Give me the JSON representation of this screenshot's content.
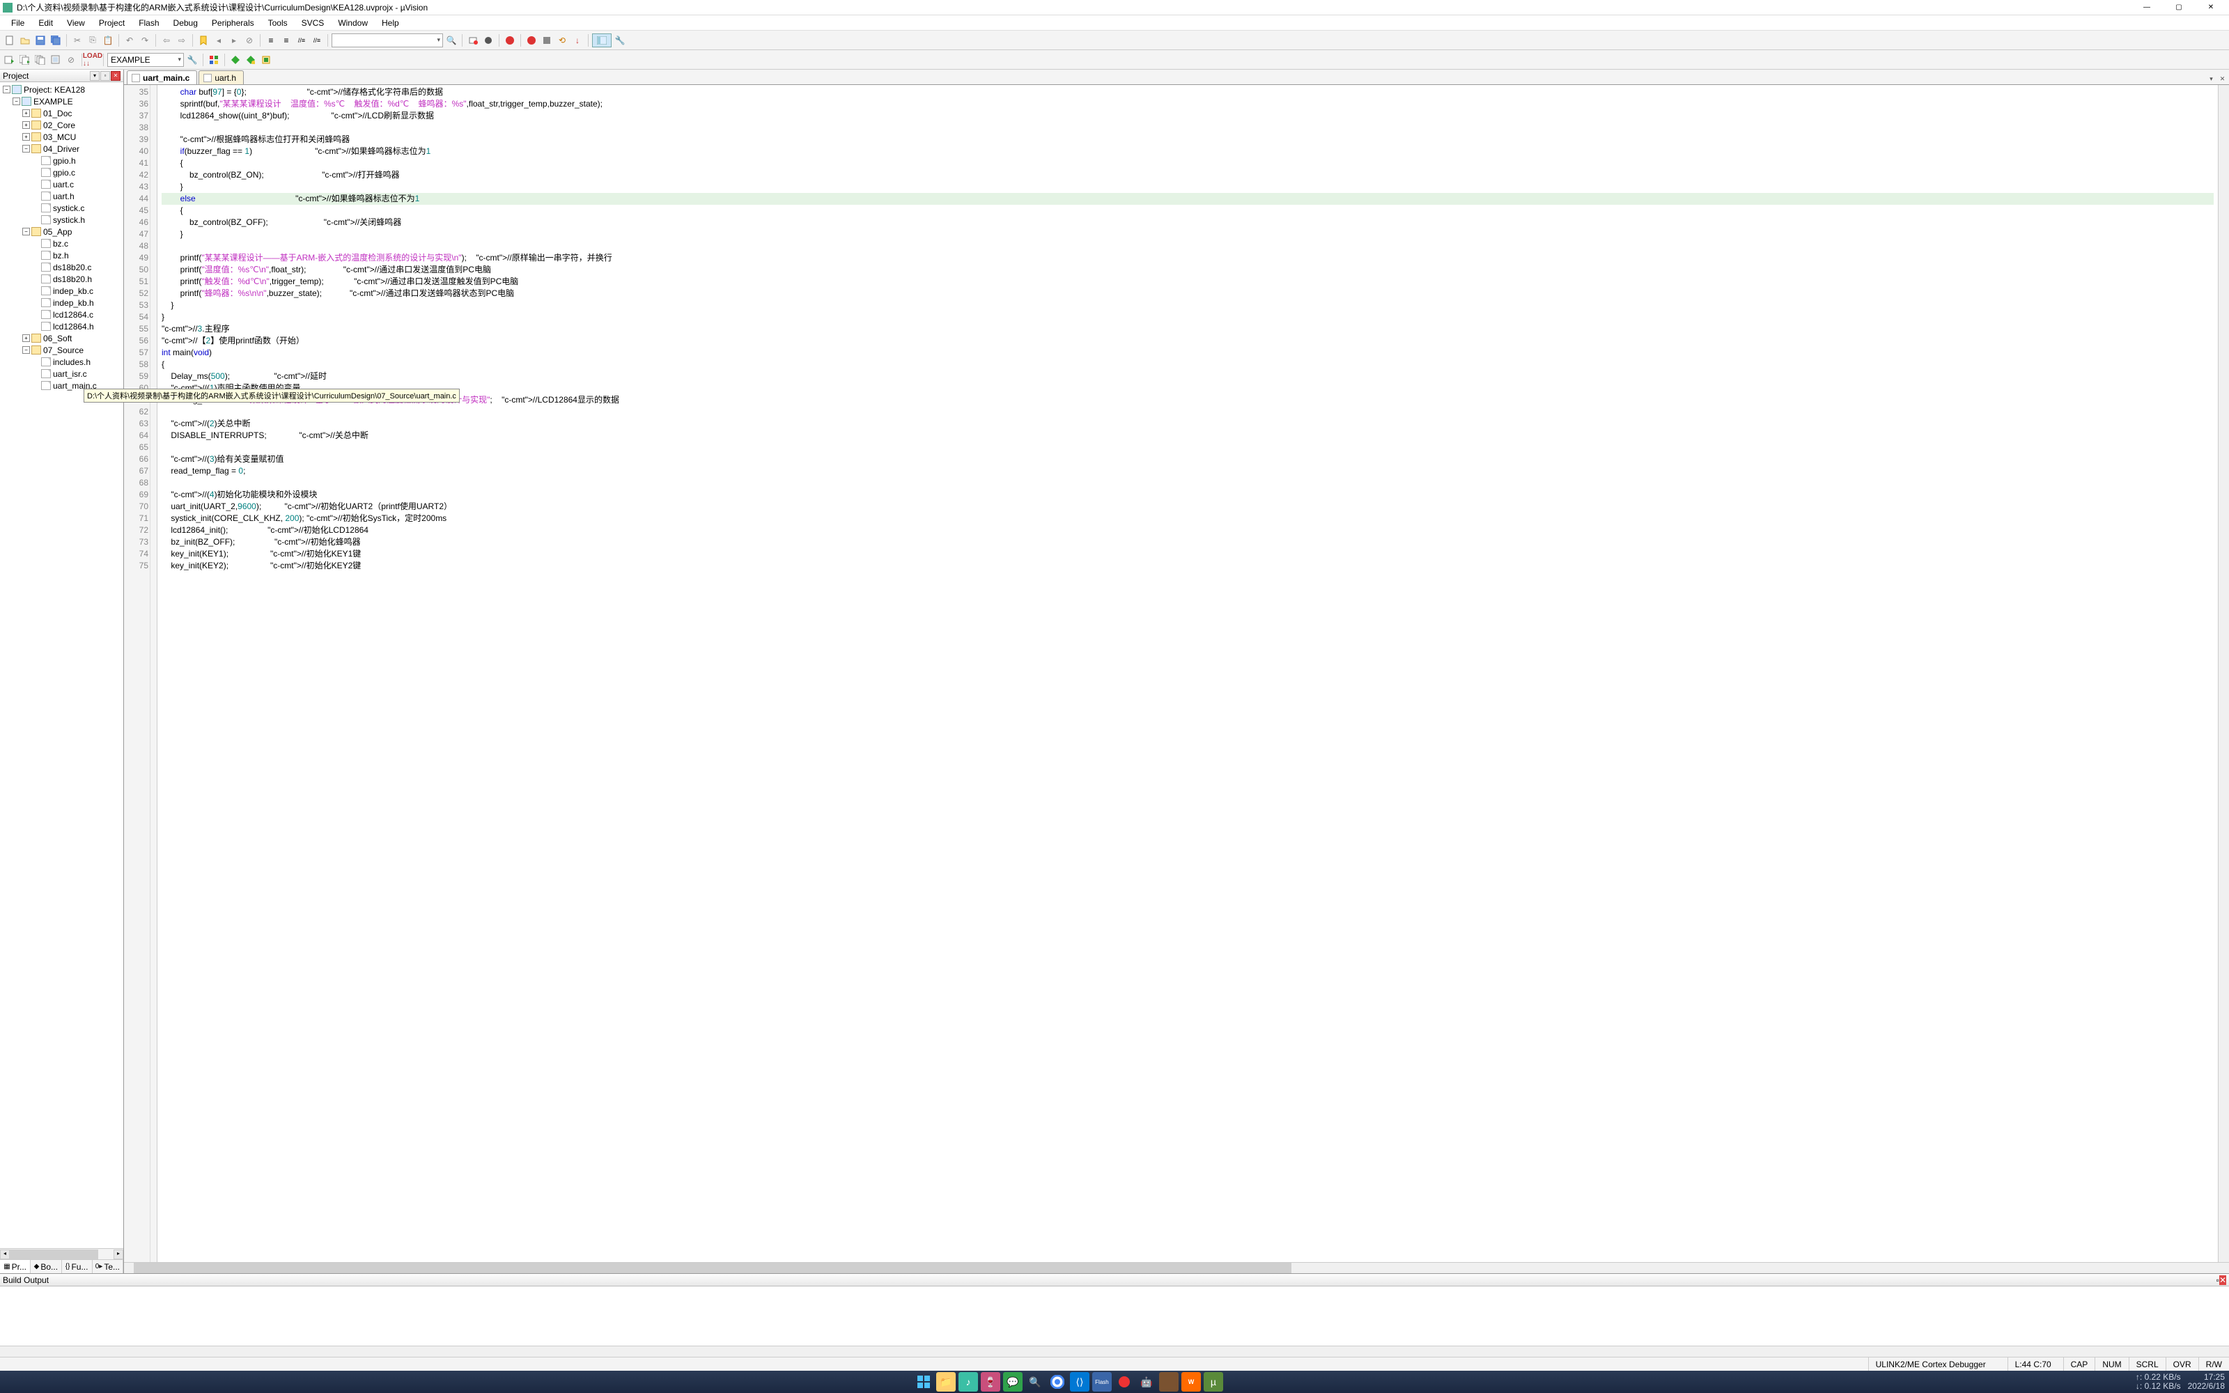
{
  "window": {
    "title": "D:\\个人资料\\视频录制\\基于构建化的ARM嵌入式系统设计\\课程设计\\CurriculumDesign\\KEA128.uvprojx - µVision"
  },
  "menu": [
    "File",
    "Edit",
    "View",
    "Project",
    "Flash",
    "Debug",
    "Peripherals",
    "Tools",
    "SVCS",
    "Window",
    "Help"
  ],
  "target_combo": "EXAMPLE",
  "search_combo": "",
  "project_panel": {
    "title": "Project",
    "tabs": [
      "Pr...",
      "Bo...",
      "Fu...",
      "Te..."
    ],
    "root": "Project: KEA128",
    "target": "EXAMPLE",
    "folders": [
      {
        "name": "01_Doc",
        "expanded": false
      },
      {
        "name": "02_Core",
        "expanded": false
      },
      {
        "name": "03_MCU",
        "expanded": false
      },
      {
        "name": "04_Driver",
        "expanded": true,
        "files": [
          "gpio.h",
          "gpio.c",
          "uart.c",
          "uart.h",
          "systick.c",
          "systick.h"
        ]
      },
      {
        "name": "05_App",
        "expanded": true,
        "files": [
          "bz.c",
          "bz.h",
          "ds18b20.c",
          "ds18b20.h",
          "indep_kb.c",
          "indep_kb.h",
          "lcd12864.c",
          "lcd12864.h"
        ]
      },
      {
        "name": "06_Soft",
        "expanded": false
      },
      {
        "name": "07_Source",
        "expanded": true,
        "files": [
          "includes.h",
          "uart_isr.c",
          "uart_main.c"
        ]
      }
    ]
  },
  "editor": {
    "tabs": [
      {
        "name": "uart_main.c",
        "active": true
      },
      {
        "name": "uart.h",
        "active": false
      }
    ],
    "tooltip_path": "D:\\个人资料\\视频录制\\基于构建化的ARM嵌入式系统设计\\课程设计\\CurriculumDesign\\07_Source\\uart_main.c",
    "first_line": 35,
    "highlight_line": 44,
    "lines": [
      {
        "n": 35,
        "t": "        char buf[97] = {0};                          //储存格式化字符串后的数据"
      },
      {
        "n": 36,
        "t": "        sprintf(buf,\"某某某课程设计    温度值：%s℃    触发值：%d℃    蜂鸣器：%s\",float_str,trigger_temp,buzzer_state);"
      },
      {
        "n": 37,
        "t": "        lcd12864_show((uint_8*)buf);                  //LCD刷新显示数据"
      },
      {
        "n": 38,
        "t": ""
      },
      {
        "n": 39,
        "t": "        //根据蜂鸣器标志位打开和关闭蜂鸣器"
      },
      {
        "n": 40,
        "t": "        if(buzzer_flag == 1)                           //如果蜂鸣器标志位为1"
      },
      {
        "n": 41,
        "t": "        {"
      },
      {
        "n": 42,
        "t": "            bz_control(BZ_ON);                         //打开蜂鸣器"
      },
      {
        "n": 43,
        "t": "        }"
      },
      {
        "n": 44,
        "t": "        else                                           //如果蜂鸣器标志位不为1"
      },
      {
        "n": 45,
        "t": "        {"
      },
      {
        "n": 46,
        "t": "            bz_control(BZ_OFF);                        //关闭蜂鸣器"
      },
      {
        "n": 47,
        "t": "        }"
      },
      {
        "n": 48,
        "t": ""
      },
      {
        "n": 49,
        "t": "        printf(\"某某某课程设计——基于ARM-嵌入式的温度检测系统的设计与实现\\n\");    //原样输出一串字符，并换行"
      },
      {
        "n": 50,
        "t": "        printf(\"温度值：%s℃\\n\",float_str);                //通过串口发送温度值到PC电脑"
      },
      {
        "n": 51,
        "t": "        printf(\"触发值：%d℃\\n\",trigger_temp);             //通过串口发送温度触发值到PC电脑"
      },
      {
        "n": 52,
        "t": "        printf(\"蜂鸣器：%s\\n\\n\",buzzer_state);            //通过串口发送蜂鸣器状态到PC电脑"
      },
      {
        "n": 53,
        "t": "    }"
      },
      {
        "n": 54,
        "t": "}"
      },
      {
        "n": 55,
        "t": "//3.主程序"
      },
      {
        "n": 56,
        "t": "//【2】使用printf函数（开始）"
      },
      {
        "n": 57,
        "t": "int main(void)"
      },
      {
        "n": 58,
        "t": "{"
      },
      {
        "n": 59,
        "t": "    Delay_ms(500);                   //延时"
      },
      {
        "n": 60,
        "t": "    //(1)声明主函数使用的变量"
      },
      {
        "n": 61,
        "t": "    char *g_LCDbuff1 = \"某某某课程设计   基于ARM-嵌入式的温度检测系统的设计与实现\";    //LCD12864显示的数据"
      },
      {
        "n": 62,
        "t": ""
      },
      {
        "n": 63,
        "t": "    //(2)关总中断"
      },
      {
        "n": 64,
        "t": "    DISABLE_INTERRUPTS;              //关总中断"
      },
      {
        "n": 65,
        "t": ""
      },
      {
        "n": 66,
        "t": "    //(3)给有关变量赋初值"
      },
      {
        "n": 67,
        "t": "    read_temp_flag = 0;"
      },
      {
        "n": 68,
        "t": ""
      },
      {
        "n": 69,
        "t": "    //(4)初始化功能模块和外设模块"
      },
      {
        "n": 70,
        "t": "    uart_init(UART_2,9600);          //初始化UART2（printf使用UART2）"
      },
      {
        "n": 71,
        "t": "    systick_init(CORE_CLK_KHZ, 200); //初始化SysTick，定时200ms"
      },
      {
        "n": 72,
        "t": "    lcd12864_init();                 //初始化LCD12864"
      },
      {
        "n": 73,
        "t": "    bz_init(BZ_OFF);                 //初始化蜂鸣器"
      },
      {
        "n": 74,
        "t": "    key_init(KEY1);                  //初始化KEY1键"
      },
      {
        "n": 75,
        "t": "    key_init(KEY2);                  //初始化KEY2键"
      }
    ]
  },
  "build_output": {
    "title": "Build Output"
  },
  "status": {
    "debugger": "ULINK2/ME Cortex Debugger",
    "cursor": "L:44 C:70",
    "caps": "CAP",
    "num": "NUM",
    "scrl": "SCRL",
    "ovr": "OVR",
    "rw": "R/W"
  },
  "taskbar": {
    "net_up": "↑: 0.22 KB/s",
    "net_down": "↓: 0.12 KB/s",
    "time": "17:25",
    "date": "2022/6/18"
  }
}
